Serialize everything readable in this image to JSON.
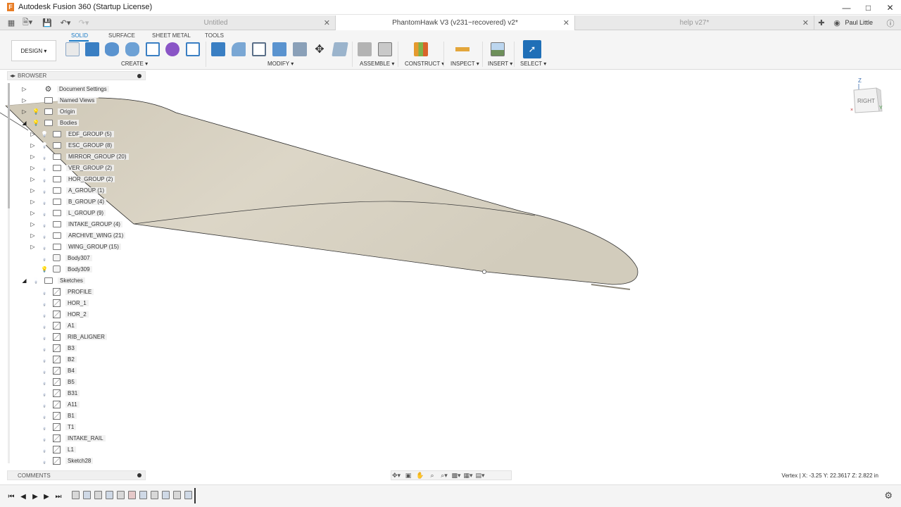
{
  "window": {
    "title": "Autodesk Fusion 360 (Startup License)",
    "app_icon": "F"
  },
  "tabs": [
    {
      "label": "Untitled",
      "active": false
    },
    {
      "label": "PhantomHawk V3 (v231~recovered) v2*",
      "active": true
    },
    {
      "label": "help v27*",
      "active": false
    }
  ],
  "user": {
    "name": "Paul Little"
  },
  "workspace_tabs": [
    "SOLID",
    "SURFACE",
    "SHEET METAL",
    "TOOLS"
  ],
  "design_button": "DESIGN ▾",
  "toolbar_groups": [
    "CREATE ▾",
    "MODIFY ▾",
    "ASSEMBLE ▾",
    "CONSTRUCT ▾",
    "INSPECT ▾",
    "INSERT ▾",
    "SELECT ▾"
  ],
  "browser": {
    "title": "BROWSER",
    "items": [
      {
        "label": "Document Settings",
        "icon": "gear",
        "depth": 0,
        "expander": "collapsed",
        "bulb": "none"
      },
      {
        "label": "Named Views",
        "icon": "folder",
        "depth": 0,
        "expander": "collapsed",
        "bulb": "none"
      },
      {
        "label": "Origin",
        "icon": "folder",
        "depth": 0,
        "expander": "collapsed",
        "bulb": "on"
      },
      {
        "label": "Bodies",
        "icon": "folder",
        "depth": 0,
        "expander": "expanded",
        "bulb": "on"
      },
      {
        "label": "EDF_GROUP (5)",
        "icon": "folder",
        "depth": 1,
        "expander": "collapsed",
        "bulb": "off"
      },
      {
        "label": "ESC_GROUP (8)",
        "icon": "folder",
        "depth": 1,
        "expander": "collapsed",
        "bulb": "off"
      },
      {
        "label": "MIRROR_GROUP (20)",
        "icon": "folder",
        "depth": 1,
        "expander": "collapsed",
        "bulb": "off"
      },
      {
        "label": "VER_GROUP (2)",
        "icon": "folder",
        "depth": 1,
        "expander": "collapsed",
        "bulb": "off"
      },
      {
        "label": "HOR_GROUP (2)",
        "icon": "folder",
        "depth": 1,
        "expander": "collapsed",
        "bulb": "off"
      },
      {
        "label": "A_GROUP (1)",
        "icon": "folder",
        "depth": 1,
        "expander": "collapsed",
        "bulb": "off"
      },
      {
        "label": "B_GROUP (4)",
        "icon": "folder",
        "depth": 1,
        "expander": "collapsed",
        "bulb": "off"
      },
      {
        "label": "L_GROUP (9)",
        "icon": "folder",
        "depth": 1,
        "expander": "collapsed",
        "bulb": "off"
      },
      {
        "label": "INTAKE_GROUP (4)",
        "icon": "folder",
        "depth": 1,
        "expander": "collapsed",
        "bulb": "off"
      },
      {
        "label": "ARCHIVE_WING (21)",
        "icon": "folder",
        "depth": 1,
        "expander": "collapsed",
        "bulb": "off"
      },
      {
        "label": "WING_GROUP (15)",
        "icon": "folder",
        "depth": 1,
        "expander": "collapsed",
        "bulb": "off"
      },
      {
        "label": "Body307",
        "icon": "body",
        "depth": 1,
        "expander": "none",
        "bulb": "off"
      },
      {
        "label": "Body309",
        "icon": "body",
        "depth": 1,
        "expander": "none",
        "bulb": "on"
      },
      {
        "label": "Sketches",
        "icon": "folder",
        "depth": 0,
        "expander": "expanded",
        "bulb": "off"
      },
      {
        "label": "PROFILE",
        "icon": "sketch",
        "depth": 1,
        "expander": "none",
        "bulb": "off"
      },
      {
        "label": "HOR_1",
        "icon": "sketch",
        "depth": 1,
        "expander": "none",
        "bulb": "off"
      },
      {
        "label": "HOR_2",
        "icon": "sketch",
        "depth": 1,
        "expander": "none",
        "bulb": "off"
      },
      {
        "label": "A1",
        "icon": "sketch",
        "depth": 1,
        "expander": "none",
        "bulb": "off"
      },
      {
        "label": "RIB_ALIGNER",
        "icon": "sketch",
        "depth": 1,
        "expander": "none",
        "bulb": "off"
      },
      {
        "label": "B3",
        "icon": "sketch",
        "depth": 1,
        "expander": "none",
        "bulb": "off"
      },
      {
        "label": "B2",
        "icon": "sketch",
        "depth": 1,
        "expander": "none",
        "bulb": "off"
      },
      {
        "label": "B4",
        "icon": "sketch",
        "depth": 1,
        "expander": "none",
        "bulb": "off"
      },
      {
        "label": "B5",
        "icon": "sketch",
        "depth": 1,
        "expander": "none",
        "bulb": "off"
      },
      {
        "label": "B31",
        "icon": "sketch",
        "depth": 1,
        "expander": "none",
        "bulb": "off"
      },
      {
        "label": "A11",
        "icon": "sketch",
        "depth": 1,
        "expander": "none",
        "bulb": "off"
      },
      {
        "label": "B1",
        "icon": "sketch",
        "depth": 1,
        "expander": "none",
        "bulb": "off"
      },
      {
        "label": "T1",
        "icon": "sketch",
        "depth": 1,
        "expander": "none",
        "bulb": "off"
      },
      {
        "label": "INTAKE_RAIL",
        "icon": "sketch",
        "depth": 1,
        "expander": "none",
        "bulb": "off"
      },
      {
        "label": "L1",
        "icon": "sketch",
        "depth": 1,
        "expander": "none",
        "bulb": "off"
      },
      {
        "label": "Sketch28",
        "icon": "sketch",
        "depth": 1,
        "expander": "none",
        "bulb": "off"
      }
    ]
  },
  "viewcube": {
    "face": "RIGHT",
    "axis_up": "Z"
  },
  "comments": {
    "title": "COMMENTS"
  },
  "status": {
    "text": "Vertex | X: -3.25 Y: 22.3617 Z: 2.822 in"
  },
  "colors": {
    "accent": "#1b7ac6",
    "body_fill": "#d8d2c3",
    "bulb_on": "#e7c22b"
  }
}
